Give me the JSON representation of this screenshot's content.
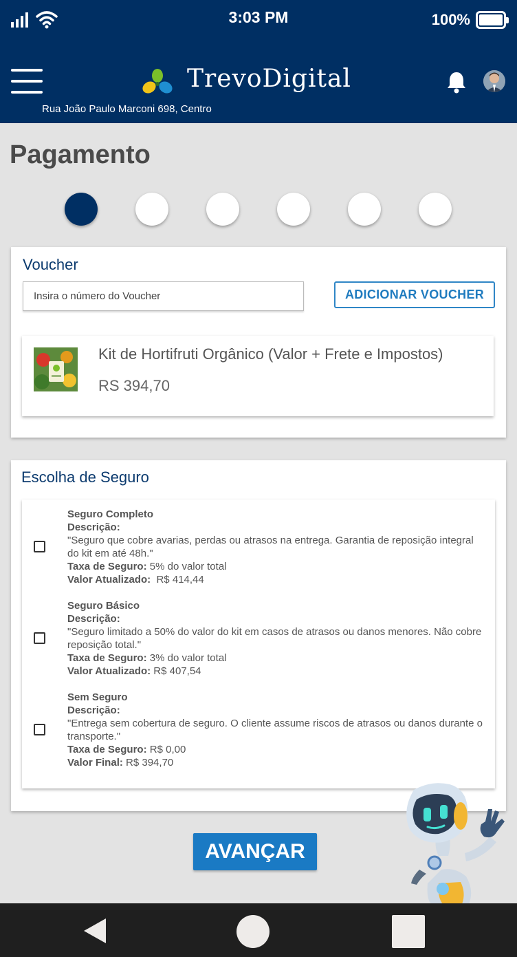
{
  "status_bar": {
    "time": "3:03 PM",
    "battery": "100%"
  },
  "header": {
    "brand": "TrevoDigital",
    "address": "Rua João Paulo Marconi 698, Centro",
    "icons": {
      "menu": "menu-icon",
      "notifications": "bell-icon",
      "profile": "avatar"
    }
  },
  "page": {
    "title": "Pagamento"
  },
  "stepper": {
    "total_steps": 6,
    "current_step": 1
  },
  "voucher": {
    "title": "Voucher",
    "input_placeholder": "Insira o número do Voucher",
    "input_value": "",
    "button_label": "ADICIONAR VOUCHER"
  },
  "product": {
    "name": "Kit de Hortifruti Orgânico (Valor + Frete e Impostos)",
    "price": "RS 394,70"
  },
  "insurance": {
    "title": "Escolha de Seguro",
    "options": [
      {
        "name": "Seguro Completo",
        "description_label": "Descrição:",
        "description": "\"Seguro que cobre avarias, perdas ou atrasos na entrega. Garantia de reposição integral do kit em até 48h.\"",
        "fee_label": "Taxa de Seguro:",
        "fee": " 5% do valor total",
        "value_label": "Valor Atualizado:",
        "value": "  R$ 414,44",
        "checked": false
      },
      {
        "name": "Seguro Básico",
        "description_label": "Descrição:",
        "description": "\"Seguro limitado a 50% do valor do kit em casos de atrasos ou danos menores. Não cobre reposição total.\"",
        "fee_label": "Taxa de Seguro:",
        "fee": " 3% do valor total",
        "value_label": "Valor Atualizado:",
        "value": " R$ 407,54",
        "checked": false
      },
      {
        "name": "Sem Seguro",
        "description_label": "Descrição:",
        "description": "\"Entrega sem cobertura de seguro. O cliente assume riscos de atrasos ou danos durante o transporte.\"",
        "fee_label": "Taxa de Seguro:",
        "fee": " R$ 0,00",
        "value_label": "Valor Final:",
        "value": " R$ 394,70",
        "checked": false
      }
    ]
  },
  "actions": {
    "next_label": "AVANÇAR"
  },
  "colors": {
    "header_bg": "#002f63",
    "accent": "#1a7ac4",
    "page_bg": "#e3e3e3",
    "nav_bg": "#1f1f1f"
  }
}
